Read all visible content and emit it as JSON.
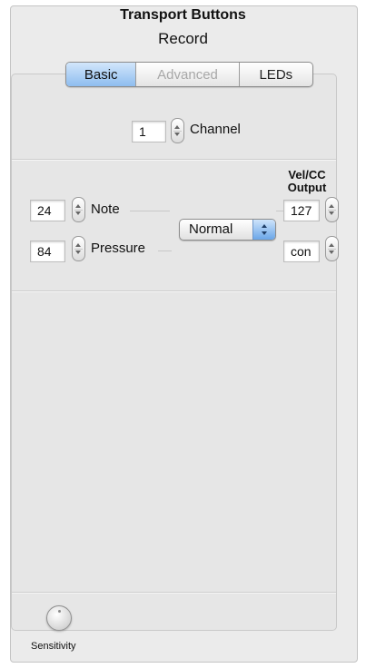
{
  "panel": {
    "title": "Transport Buttons",
    "subtitle": "Record"
  },
  "tabs": [
    {
      "label": "Basic",
      "state": "active"
    },
    {
      "label": "Advanced",
      "state": "disabled"
    },
    {
      "label": "LEDs",
      "state": "normal"
    }
  ],
  "channel": {
    "value": "1",
    "label": "Channel"
  },
  "output_header": "Vel/CC\nOutput",
  "note": {
    "value": "24",
    "label": "Note"
  },
  "pressure": {
    "value": "84",
    "label": "Pressure"
  },
  "mode_select": {
    "value": "Normal"
  },
  "velocity_output": {
    "value": "127"
  },
  "pressure_output": {
    "value": "con"
  },
  "sensitivity": {
    "label": "Sensitivity"
  },
  "colors": {
    "active_tab": "#8ebdef",
    "select_arrows": "#6aa6e8",
    "panel_bg": "#ebebeb"
  },
  "icons": [
    "stepper-icon",
    "popup-arrows-icon",
    "knob-icon"
  ]
}
